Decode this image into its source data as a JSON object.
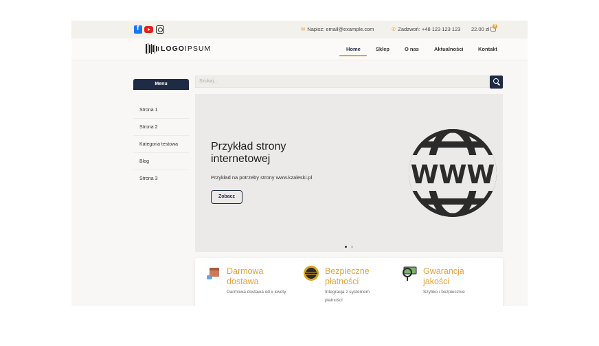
{
  "topbar": {
    "email": "Napisz: email@example.com",
    "phone": "Zadzwoń: +48 123 123 123",
    "cart_total": "22.00 zł",
    "cart_count": "0",
    "social_icons": [
      "facebook-icon",
      "youtube-icon",
      "instagram-icon"
    ]
  },
  "header": {
    "logo_bold": "LOGO",
    "logo_light": "IPSUM",
    "nav": [
      {
        "label": "Home",
        "active": true
      },
      {
        "label": "Sklep"
      },
      {
        "label": "O nas"
      },
      {
        "label": "Aktualności"
      },
      {
        "label": "Kontakt"
      }
    ]
  },
  "sidebar": {
    "title": "Menu",
    "items": [
      "Strona 1",
      "Strona 2",
      "Kategoria testowa",
      "Blog",
      "Strona 3"
    ]
  },
  "search": {
    "placeholder": "Szukaj..."
  },
  "hero": {
    "title": "Przykład strony internetowej",
    "subtitle": "Przykład na potrzeby strony www.kzaleski.pl",
    "button": "Zobacz",
    "globe_text": "WWW",
    "slides": 2,
    "active_slide": 1
  },
  "features": [
    {
      "title": "Darmowa dostawa",
      "desc": "Darmowa dostawa od x kwoty",
      "icon": "delivery-box-icon"
    },
    {
      "title": "Bezpieczne płatności",
      "desc": "Integracja z systemem płatności",
      "icon": "quality-badge-icon"
    },
    {
      "title": "Gwarancja jakości",
      "desc": "Szybko i bezpiecznie",
      "icon": "money-magnifier-icon"
    }
  ],
  "colors": {
    "accent": "#e8a23a",
    "navy": "#1f2a44"
  }
}
